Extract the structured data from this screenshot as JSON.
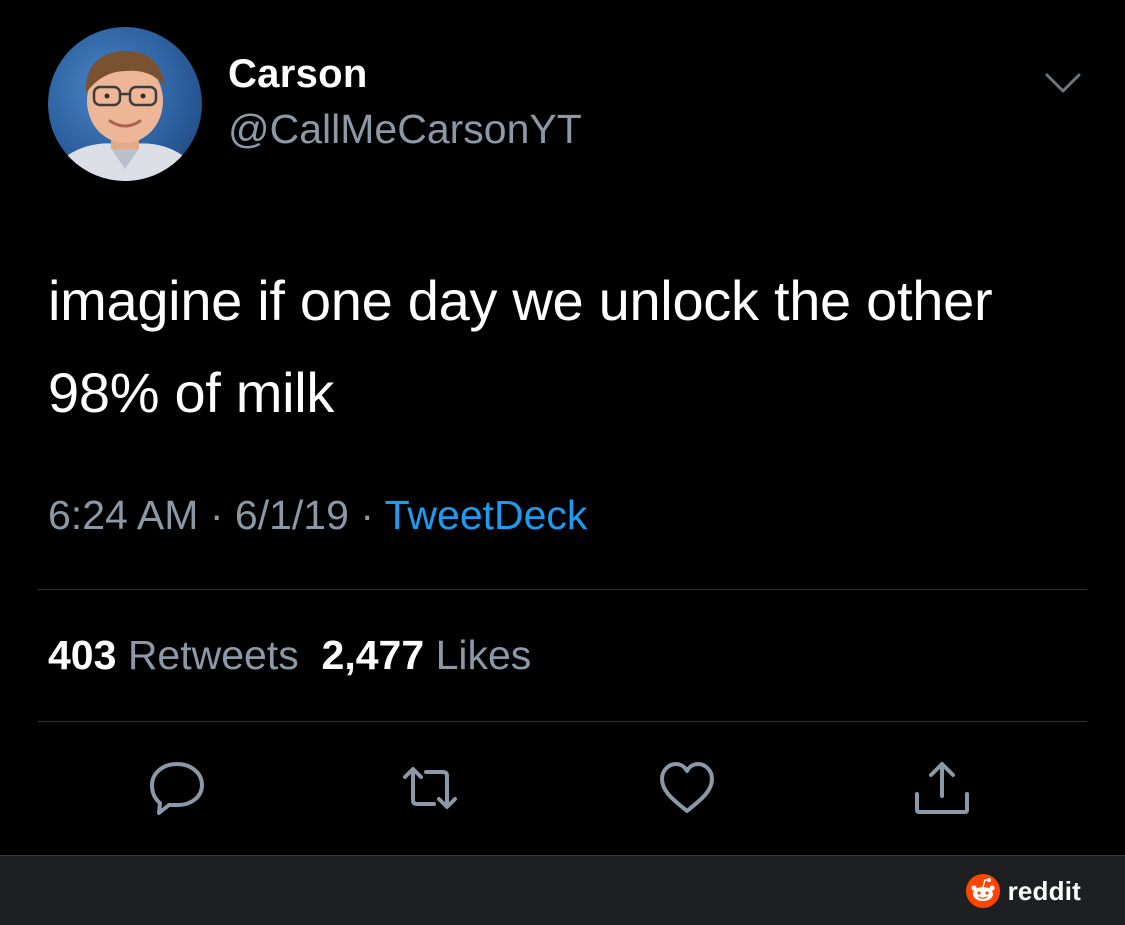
{
  "tweet": {
    "author": {
      "name": "Carson",
      "handle": "@CallMeCarsonYT"
    },
    "text": "imagine if one day we unlock the other\n98% of milk",
    "time": "6:24 AM",
    "date": "6/1/19",
    "separator": "·",
    "source": "TweetDeck",
    "retweets_count": "403",
    "retweets_label": "Retweets",
    "likes_count": "2,477",
    "likes_label": "Likes"
  },
  "icons": {
    "menu": "chevron-down-icon",
    "reply": "reply-icon",
    "retweet": "retweet-icon",
    "like": "heart-icon",
    "share": "share-icon",
    "watermark": "reddit-logo-icon"
  },
  "watermark": {
    "label": "reddit"
  },
  "colors": {
    "background": "#000000",
    "text": "#ffffff",
    "secondary_text": "#8b98a5",
    "link": "#1d9bf0",
    "reddit_orange": "#ff4500"
  }
}
